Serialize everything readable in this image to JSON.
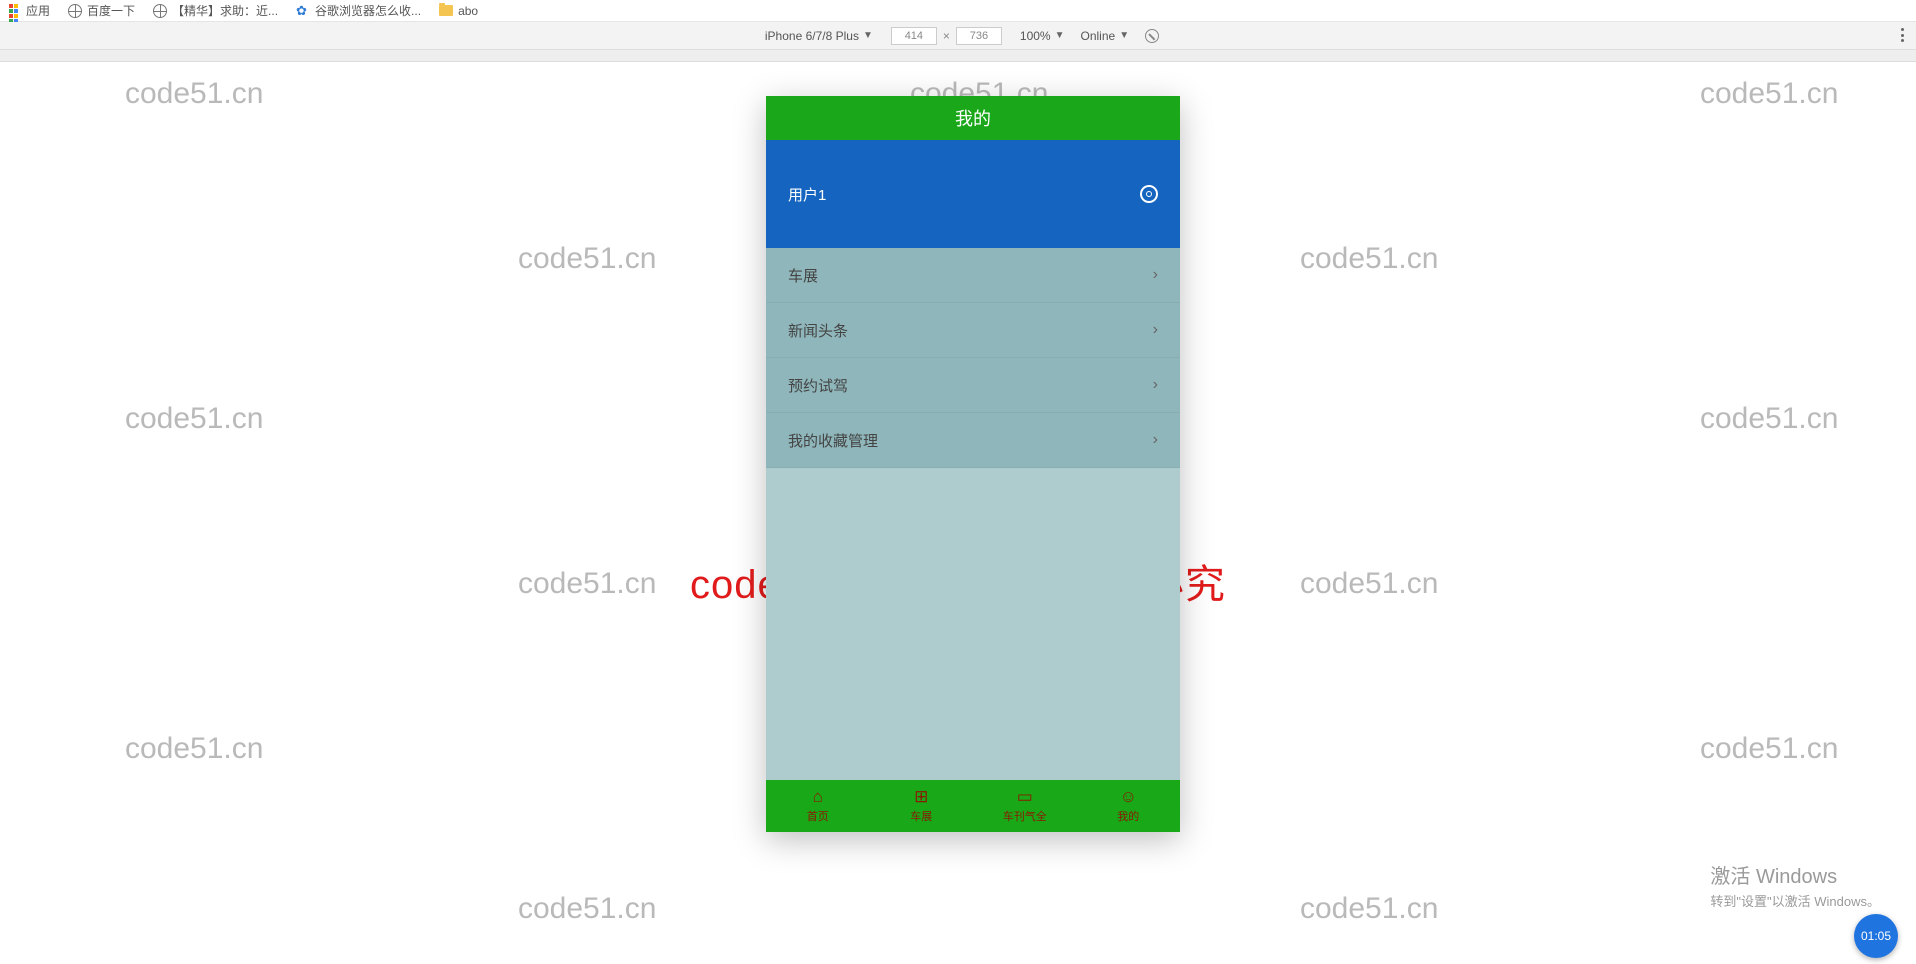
{
  "bookmarks": {
    "apps": "应用",
    "items": [
      "百度一下",
      "【精华】求助：近...",
      "谷歌浏览器怎么收...",
      "abo"
    ]
  },
  "devtools": {
    "device": "iPhone 6/7/8 Plus",
    "width": "414",
    "height": "736",
    "zoom": "100%",
    "network": "Online"
  },
  "watermark": "code51.cn",
  "watermark_red": "code51.cn-源码乐园盗图必究",
  "phone": {
    "title": "我的",
    "user": "用户1",
    "menu": [
      "车展",
      "新闻头条",
      "预约试驾",
      "我的收藏管理"
    ],
    "tabs": [
      {
        "icon": "⌂",
        "label": "首页"
      },
      {
        "icon": "⊞",
        "label": "车展"
      },
      {
        "icon": "▭",
        "label": "车刊气全"
      },
      {
        "icon": "☺",
        "label": "我的"
      }
    ]
  },
  "winact": {
    "line1": "激活 Windows",
    "line2": "转到\"设置\"以激活 Windows。"
  },
  "clock": "01:05"
}
